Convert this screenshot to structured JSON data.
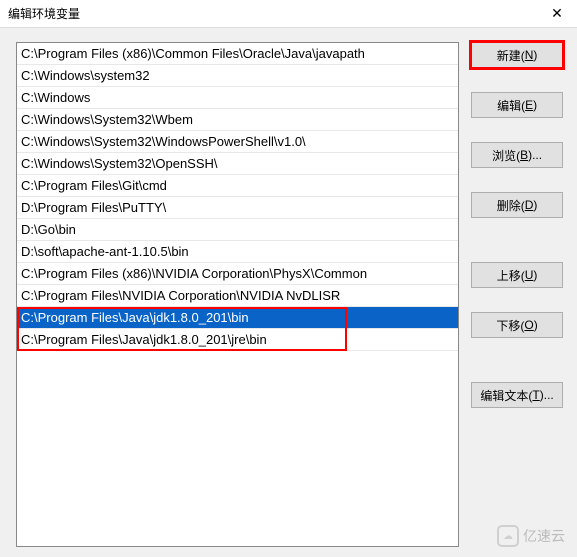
{
  "window": {
    "title": "编辑环境变量",
    "close": "✕"
  },
  "paths": [
    "C:\\Program Files (x86)\\Common Files\\Oracle\\Java\\javapath",
    "C:\\Windows\\system32",
    "C:\\Windows",
    "C:\\Windows\\System32\\Wbem",
    "C:\\Windows\\System32\\WindowsPowerShell\\v1.0\\",
    "C:\\Windows\\System32\\OpenSSH\\",
    "C:\\Program Files\\Git\\cmd",
    "D:\\Program Files\\PuTTY\\",
    "D:\\Go\\bin",
    "D:\\soft\\apache-ant-1.10.5\\bin",
    "C:\\Program Files (x86)\\NVIDIA Corporation\\PhysX\\Common",
    "C:\\Program Files\\NVIDIA Corporation\\NVIDIA NvDLISR",
    "C:\\Program Files\\Java\\jdk1.8.0_201\\bin",
    "C:\\Program Files\\Java\\jdk1.8.0_201\\jre\\bin"
  ],
  "selectedIndex": 12,
  "highlightRange": {
    "start": 12,
    "end": 13
  },
  "buttons": {
    "new": {
      "pre": "新建(",
      "u": "N",
      "post": ")",
      "hl": true
    },
    "edit": {
      "pre": "编辑(",
      "u": "E",
      "post": ")",
      "hl": false
    },
    "browse": {
      "pre": "浏览(",
      "u": "B",
      "post": ")...",
      "hl": false
    },
    "delete": {
      "pre": "删除(",
      "u": "D",
      "post": ")",
      "hl": false
    },
    "moveUp": {
      "pre": "上移(",
      "u": "U",
      "post": ")",
      "hl": false
    },
    "moveDown": {
      "pre": "下移(",
      "u": "O",
      "post": ")",
      "hl": false
    },
    "editText": {
      "pre": "编辑文本(",
      "u": "T",
      "post": ")...",
      "hl": false
    }
  },
  "watermark": "亿速云"
}
